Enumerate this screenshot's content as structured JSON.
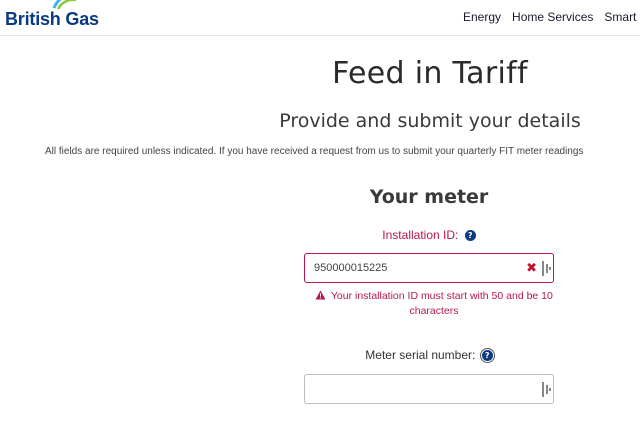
{
  "header": {
    "logo_text": "British Gas",
    "nav": [
      "Energy",
      "Home Services",
      "Smart"
    ]
  },
  "main": {
    "title": "Feed in Tariff",
    "subtitle": "Provide and submit your details",
    "intro": "All fields are required unless indicated. If you have received a request from us to submit your quarterly FIT meter readings"
  },
  "meter": {
    "section_title": "Your meter",
    "installation_id": {
      "label": "Installation ID:",
      "value": "950000015225",
      "error": "Your installation ID must start with 50 and be 10 characters"
    },
    "serial": {
      "label": "Meter serial number:",
      "value": ""
    }
  },
  "icons": {
    "help": "question-circle-icon",
    "clear": "close-x-icon",
    "warning": "warning-triangle-icon"
  },
  "colors": {
    "brand_blue": "#0b3a82",
    "error_magenta": "#b5174e",
    "clear_red": "#c8102e"
  }
}
